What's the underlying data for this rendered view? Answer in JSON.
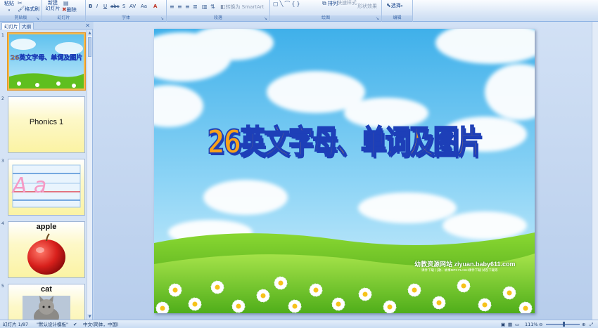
{
  "ribbon": {
    "clipboard": {
      "paste": "粘贴",
      "format_painter": "格式刷",
      "label": "剪贴板"
    },
    "slides": {
      "new_slide_line1": "新建",
      "new_slide_line2": "幻灯片",
      "delete": "删除",
      "label": "幻灯片"
    },
    "font": {
      "label": "字体",
      "bold": "B",
      "italic": "I",
      "underline": "U",
      "strike": "abc",
      "shadow": "S",
      "spacing": "AV",
      "case": "Aa",
      "color": "A"
    },
    "paragraph": {
      "label": "段落",
      "smartart": "转换为 SmartArt"
    },
    "drawing": {
      "label": "绘图",
      "arrange": "排列",
      "quick_styles": "快速样式",
      "shape_effects": "形状效果"
    },
    "editing": {
      "label": "编辑",
      "select": "选择"
    }
  },
  "panel": {
    "tabs": [
      "幻灯片",
      "大纲"
    ],
    "thumbnails": [
      {
        "num": "1",
        "text": "26英文字母、单词及图片"
      },
      {
        "num": "2",
        "text": "Phonics 1"
      },
      {
        "num": "3",
        "text": "A a"
      },
      {
        "num": "4",
        "text": "apple"
      },
      {
        "num": "5",
        "text": "cat"
      }
    ]
  },
  "slide": {
    "title": "26英文字母、单词及图片",
    "watermark_main": "幼教资源网站  ziyuan.baby611.com",
    "watermark_sub": "课件下载   儿歌、故事MP3   FLASH课件下载   试卷下载等"
  },
  "status": {
    "slide_info": "幻灯片 1/87",
    "template": "\"默认设计模板\"",
    "language": "中文(简体，中国)",
    "zoom": "111%"
  },
  "colors": {
    "title_fill": "#f8a21a",
    "title_outline": "#1d3fb8",
    "sky_top": "#5fc2ee",
    "grass": "#5fbf1f"
  }
}
